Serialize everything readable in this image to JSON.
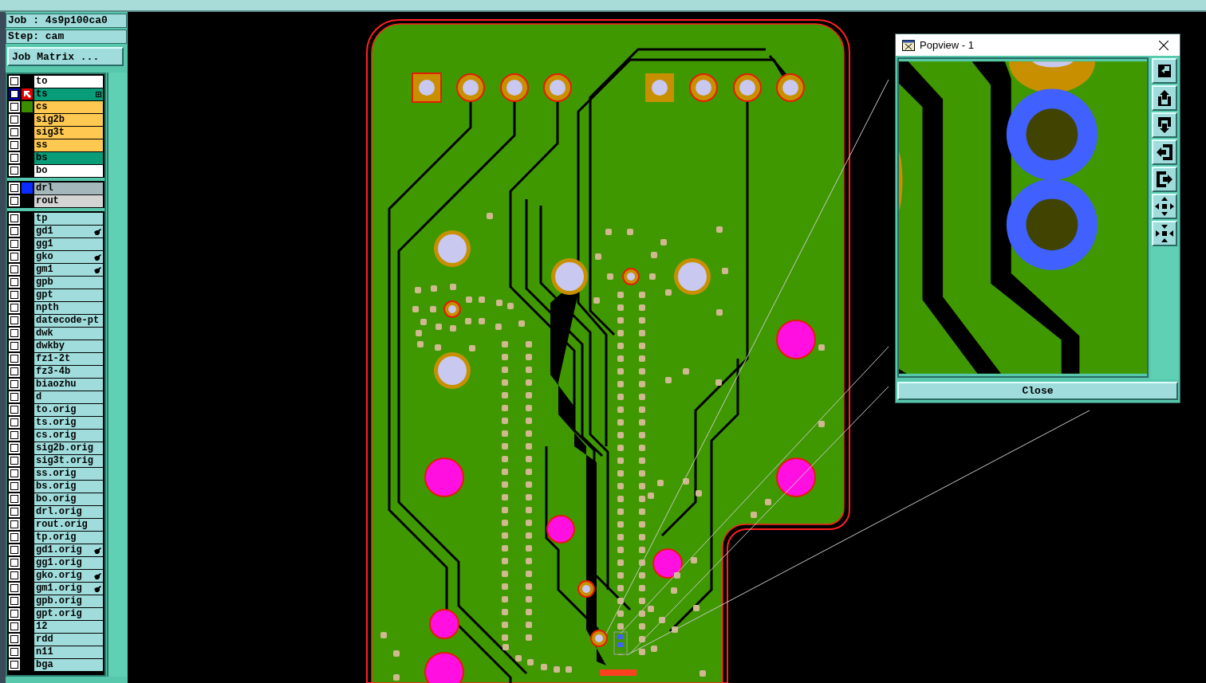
{
  "job_label": "Job : 4s9p100ca0",
  "step_label": "Step: cam",
  "job_matrix_button": "Job Matrix ...",
  "layer_groups": [
    {
      "layers": [
        {
          "name": "to",
          "kind": "silk",
          "checked": false,
          "active": false,
          "linked": false
        },
        {
          "name": "ts",
          "kind": "mask",
          "checked": false,
          "active": true,
          "linked": false
        },
        {
          "name": "cs",
          "kind": "signal",
          "checked": false,
          "active": false,
          "linked": false,
          "color": "#3c8c00"
        },
        {
          "name": "sig2b",
          "kind": "signal",
          "checked": false,
          "active": false,
          "linked": false
        },
        {
          "name": "sig3t",
          "kind": "signal",
          "checked": false,
          "active": false,
          "linked": false
        },
        {
          "name": "ss",
          "kind": "signal",
          "checked": false,
          "active": false,
          "linked": false
        },
        {
          "name": "bs",
          "kind": "mask",
          "checked": false,
          "active": false,
          "linked": false
        },
        {
          "name": "bo",
          "kind": "silk",
          "checked": false,
          "active": false,
          "linked": false
        }
      ]
    },
    {
      "layers": [
        {
          "name": "drl",
          "kind": "drill",
          "checked": false,
          "active": false,
          "linked": false,
          "color": "#0a2cff"
        },
        {
          "name": "rout",
          "kind": "rout",
          "checked": false,
          "active": false,
          "linked": false
        }
      ]
    },
    {
      "layers": [
        {
          "name": "tp",
          "kind": "misc",
          "checked": false,
          "active": false,
          "linked": false
        },
        {
          "name": "gd1",
          "kind": "misc",
          "checked": false,
          "active": false,
          "linked": true
        },
        {
          "name": "gg1",
          "kind": "misc",
          "checked": false,
          "active": false,
          "linked": false
        },
        {
          "name": "gko",
          "kind": "misc",
          "checked": false,
          "active": false,
          "linked": true
        },
        {
          "name": "gm1",
          "kind": "misc",
          "checked": false,
          "active": false,
          "linked": true
        },
        {
          "name": "gpb",
          "kind": "misc",
          "checked": false,
          "active": false,
          "linked": false
        },
        {
          "name": "gpt",
          "kind": "misc",
          "checked": false,
          "active": false,
          "linked": false
        },
        {
          "name": "npth",
          "kind": "misc",
          "checked": false,
          "active": false,
          "linked": false
        },
        {
          "name": "datecode-pt",
          "kind": "misc",
          "checked": false,
          "active": false,
          "linked": false
        },
        {
          "name": "dwk",
          "kind": "misc",
          "checked": false,
          "active": false,
          "linked": false
        },
        {
          "name": "dwkby",
          "kind": "misc",
          "checked": false,
          "active": false,
          "linked": false
        },
        {
          "name": "fz1-2t",
          "kind": "misc",
          "checked": false,
          "active": false,
          "linked": false
        },
        {
          "name": "fz3-4b",
          "kind": "misc",
          "checked": false,
          "active": false,
          "linked": false
        },
        {
          "name": "biaozhu",
          "kind": "misc",
          "checked": false,
          "active": false,
          "linked": false
        },
        {
          "name": "d",
          "kind": "misc",
          "checked": false,
          "active": false,
          "linked": false
        },
        {
          "name": "to.orig",
          "kind": "misc",
          "checked": false,
          "active": false,
          "linked": false
        },
        {
          "name": "ts.orig",
          "kind": "misc",
          "checked": false,
          "active": false,
          "linked": false
        },
        {
          "name": "cs.orig",
          "kind": "misc",
          "checked": false,
          "active": false,
          "linked": false
        },
        {
          "name": "sig2b.orig",
          "kind": "misc",
          "checked": false,
          "active": false,
          "linked": false
        },
        {
          "name": "sig3t.orig",
          "kind": "misc",
          "checked": false,
          "active": false,
          "linked": false
        },
        {
          "name": "ss.orig",
          "kind": "misc",
          "checked": false,
          "active": false,
          "linked": false
        },
        {
          "name": "bs.orig",
          "kind": "misc",
          "checked": false,
          "active": false,
          "linked": false
        },
        {
          "name": "bo.orig",
          "kind": "misc",
          "checked": false,
          "active": false,
          "linked": false
        },
        {
          "name": "drl.orig",
          "kind": "misc",
          "checked": false,
          "active": false,
          "linked": false
        },
        {
          "name": "rout.orig",
          "kind": "misc",
          "checked": false,
          "active": false,
          "linked": false
        },
        {
          "name": "tp.orig",
          "kind": "misc",
          "checked": false,
          "active": false,
          "linked": false
        },
        {
          "name": "gd1.orig",
          "kind": "misc",
          "checked": false,
          "active": false,
          "linked": true
        },
        {
          "name": "gg1.orig",
          "kind": "misc",
          "checked": false,
          "active": false,
          "linked": false
        },
        {
          "name": "gko.orig",
          "kind": "misc",
          "checked": false,
          "active": false,
          "linked": true
        },
        {
          "name": "gm1.orig",
          "kind": "misc",
          "checked": false,
          "active": false,
          "linked": true
        },
        {
          "name": "gpb.orig",
          "kind": "misc",
          "checked": false,
          "active": false,
          "linked": false
        },
        {
          "name": "gpt.orig",
          "kind": "misc",
          "checked": false,
          "active": false,
          "linked": false
        },
        {
          "name": "12",
          "kind": "misc",
          "checked": false,
          "active": false,
          "linked": false
        },
        {
          "name": "rdd",
          "kind": "misc",
          "checked": false,
          "active": false,
          "linked": false
        },
        {
          "name": "n11",
          "kind": "misc",
          "checked": false,
          "active": false,
          "linked": false
        },
        {
          "name": "bga",
          "kind": "misc",
          "checked": false,
          "active": false,
          "linked": false
        }
      ]
    }
  ],
  "popview": {
    "title": "Popview - 1",
    "close_button": "Close"
  }
}
